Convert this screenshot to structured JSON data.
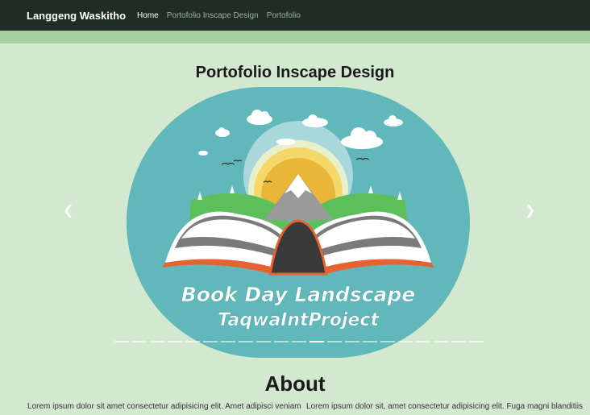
{
  "navbar": {
    "brand": "Langgeng Waskitho",
    "links": [
      {
        "label": "Home",
        "active": true
      },
      {
        "label": "Portofolio Inscape Design",
        "active": false
      },
      {
        "label": "Portofolio",
        "active": false
      }
    ]
  },
  "portfolio": {
    "title": "Portofolio Inscape Design",
    "slide": {
      "line1": "Book Day Landscape",
      "line2": "TaqwaIntProject"
    },
    "indicator_count": 21,
    "active_indicator": 11,
    "prev_icon": "chevron-left-icon",
    "next_icon": "chevron-right-icon"
  },
  "about": {
    "title": "About",
    "left_text": "Lorem ipsum dolor sit amet consectetur adipisicing elit. Amet adipisci veniam",
    "right_text": "Lorem ipsum dolor sit, amet consectetur adipisicing elit. Fuga magni blanditiis"
  },
  "colors": {
    "navbar": "#1f2d24",
    "page_bg": "#d2e8cf",
    "strip": "#a6cfa0",
    "circle": "#60b8bb"
  }
}
